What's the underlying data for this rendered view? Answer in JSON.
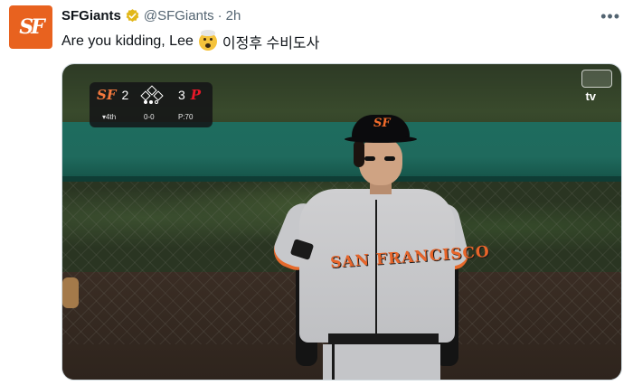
{
  "tweet": {
    "display_name": "SFGiants",
    "handle": "@SFGiants",
    "separator": "·",
    "time": "2h",
    "text_before_emoji": "Are you kidding, Lee",
    "emoji_icon": "exploding-head-emoji",
    "text_after_emoji": "이정후 수비도사",
    "more_label": "•••"
  },
  "avatar": {
    "text": "SF",
    "bg": "#e8621f"
  },
  "verified_color": "#e2b719",
  "scorebug": {
    "away_team_logo": "SF",
    "away_score": "2",
    "home_team_logo": "P",
    "home_score": "3",
    "inning": "▾4th",
    "count": "0-0",
    "pitch_count": "P:70"
  },
  "broadcast": {
    "network": "tv",
    "network_icon": "apple-logo-icon"
  },
  "jersey_text": "SAN FRANCISCO"
}
